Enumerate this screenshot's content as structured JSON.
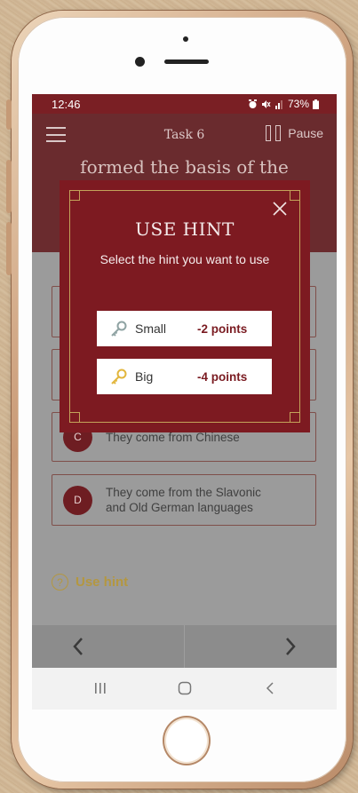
{
  "status_bar": {
    "time": "12:46",
    "icons": [
      "alarm-icon",
      "mute-icon",
      "signal-icon"
    ],
    "battery": "73%"
  },
  "header": {
    "title": "Task 6",
    "pause_label": "Pause"
  },
  "question": {
    "text": "formed the basis of the"
  },
  "answers": [
    {
      "letter": "C",
      "text": "They come from Chinese"
    },
    {
      "letter": "D",
      "text": "They come from the Slavonic and Old German languages"
    }
  ],
  "use_hint": {
    "label": "Use hint",
    "icon_char": "?"
  },
  "modal": {
    "title": "USE HINT",
    "subtitle": "Select the hint you want to use",
    "options": [
      {
        "size": "Small",
        "points": "-2 points",
        "key_color": "#8fa3a3"
      },
      {
        "size": "Big",
        "points": "-4 points",
        "key_color": "#e2b63c"
      }
    ]
  },
  "colors": {
    "accent": "#7d1a21",
    "header": "#6a2b2e",
    "gold": "#c4a35a",
    "hint": "#b49740"
  }
}
